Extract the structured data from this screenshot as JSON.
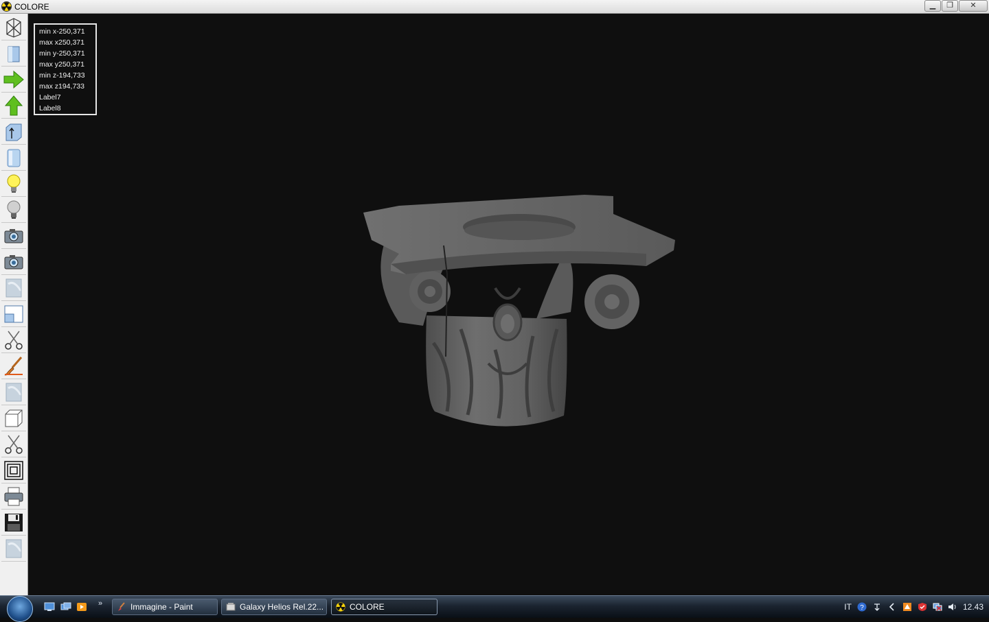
{
  "window": {
    "title": "COLORE",
    "buttons": {
      "minimize": "▁",
      "restore": "❐",
      "close": "✕"
    }
  },
  "toolbar": {
    "tools": [
      {
        "name": "wireframe-icon"
      },
      {
        "name": "solid-cube-icon"
      },
      {
        "name": "arrow-right-icon"
      },
      {
        "name": "arrow-up-icon"
      },
      {
        "name": "cube-axis-icon"
      },
      {
        "name": "cylinder-icon"
      },
      {
        "name": "light-on-icon"
      },
      {
        "name": "light-off-icon"
      },
      {
        "name": "camera-icon"
      },
      {
        "name": "camera-2-icon"
      },
      {
        "name": "texture-icon"
      },
      {
        "name": "window-icon"
      },
      {
        "name": "scissors-icon"
      },
      {
        "name": "paint-brush-icon"
      },
      {
        "name": "texture-2-icon"
      },
      {
        "name": "box-icon"
      },
      {
        "name": "scissors-2-icon"
      },
      {
        "name": "concentric-square-icon"
      },
      {
        "name": "printer-icon"
      },
      {
        "name": "save-disk-icon"
      },
      {
        "name": "texture-3-icon"
      }
    ]
  },
  "info": {
    "lines": [
      "min x-250,371",
      "max x250,371",
      "min y-250,371",
      "max y250,371",
      "min z-194,733",
      "max z194,733",
      "Label7",
      "Label8"
    ]
  },
  "taskbar": {
    "more": "»",
    "tasks": [
      {
        "label": "Immagine - Paint"
      },
      {
        "label": "Galaxy Helios  Rel.22..."
      },
      {
        "label": "COLORE"
      }
    ],
    "tray": {
      "lang": "IT",
      "clock": "12.43"
    }
  },
  "colors": {
    "viewport": "#0f0f0f",
    "model": "#6a6a6a",
    "accent": "#f5d20a"
  }
}
